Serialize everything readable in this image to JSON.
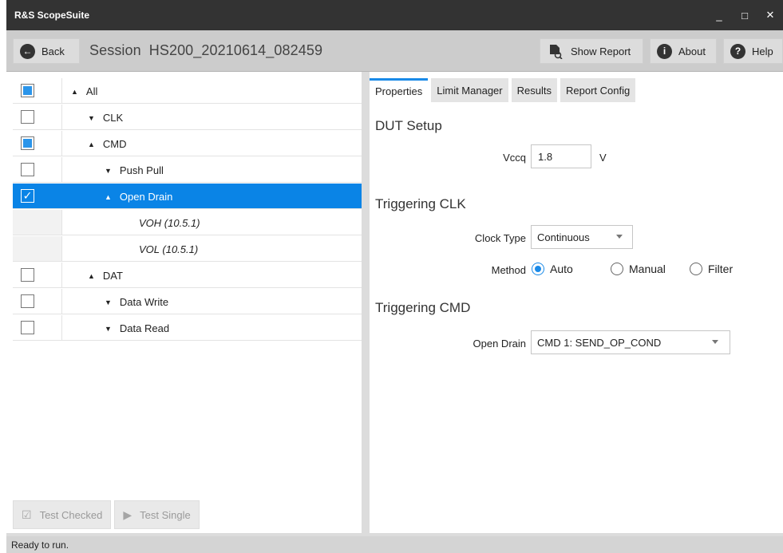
{
  "app": {
    "title": "R&S ScopeSuite"
  },
  "window_controls": {
    "minimize": "_",
    "maximize": "□",
    "close": "✕"
  },
  "toolbar": {
    "back_label": "Back",
    "session_prefix": "Session",
    "session_name": "HS200_20210614_082459",
    "show_report_label": "Show Report",
    "about_label": "About",
    "help_label": "Help"
  },
  "tree": {
    "items": [
      {
        "label": "All",
        "state": "partial",
        "expanded": true
      },
      {
        "label": "CLK",
        "state": "unchecked",
        "expanded": false
      },
      {
        "label": "CMD",
        "state": "partial",
        "expanded": true
      },
      {
        "label": "Push Pull",
        "state": "unchecked",
        "expanded": false
      },
      {
        "label": "Open Drain",
        "state": "checked",
        "expanded": true,
        "selected": true
      },
      {
        "label": "VOH (10.5.1)",
        "state": "leaf"
      },
      {
        "label": "VOL (10.5.1)",
        "state": "leaf"
      },
      {
        "label": "DAT",
        "state": "unchecked",
        "expanded": true
      },
      {
        "label": "Data Write",
        "state": "unchecked",
        "expanded": false
      },
      {
        "label": "Data Read",
        "state": "unchecked",
        "expanded": false
      }
    ]
  },
  "actions": {
    "test_checked": "Test Checked",
    "test_single": "Test Single"
  },
  "tabs": [
    {
      "label": "Properties",
      "active": true
    },
    {
      "label": "Limit Manager",
      "active": false
    },
    {
      "label": "Results",
      "active": false
    },
    {
      "label": "Report Config",
      "active": false
    }
  ],
  "properties": {
    "dut_setup": {
      "title": "DUT Setup",
      "vccq_label": "Vccq",
      "vccq_value": "1.8",
      "vccq_unit": "V"
    },
    "triggering_clk": {
      "title": "Triggering CLK",
      "clock_type_label": "Clock Type",
      "clock_type_value": "Continuous",
      "method_label": "Method",
      "method_options": [
        "Auto",
        "Manual",
        "Filter"
      ],
      "method_selected": "Auto"
    },
    "triggering_cmd": {
      "title": "Triggering CMD",
      "open_drain_label": "Open Drain",
      "open_drain_value": "CMD 1: SEND_OP_COND"
    }
  },
  "status": {
    "text": "Ready to run."
  },
  "colors": {
    "accent": "#0a84e6",
    "titlebar": "#333333",
    "toolbar": "#cccccc"
  }
}
